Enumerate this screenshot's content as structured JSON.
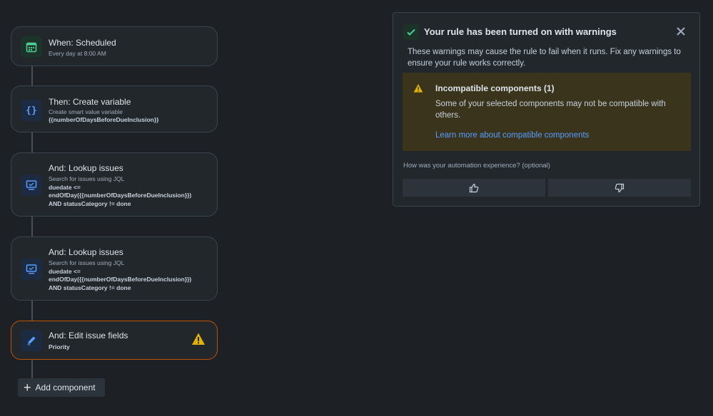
{
  "rule_steps": [
    {
      "title": "When: Scheduled",
      "subtitle": "Every day at 8:00 AM",
      "icon": "calendar-icon"
    },
    {
      "title": "Then: Create variable",
      "subtitle": "Create smart value variable",
      "detail": "{{numberOfDaysBeforeDueInclusion}}",
      "icon": "braces-icon"
    },
    {
      "title": "And: Lookup issues",
      "subtitle": "Search for issues using JQL",
      "detail_lines": [
        "duedate <=",
        "endOfDay({{numberOfDaysBeforeDueInclusion}})",
        "AND statusCategory != done"
      ],
      "icon": "monitor-icon"
    },
    {
      "title": "And: Lookup issues",
      "subtitle": "Search for issues using JQL",
      "detail_lines": [
        "duedate <=",
        "endOfDay({{numberOfDaysBeforeDueInclusion}})",
        "AND statusCategory != done"
      ],
      "icon": "monitor-icon"
    },
    {
      "title": "And: Edit issue fields",
      "detail": "Priority",
      "icon": "pencil-icon",
      "status": "warning"
    }
  ],
  "add_component_label": "Add component",
  "flag": {
    "title": "Your rule has been turned on with warnings",
    "description": "These warnings may cause the rule to fail when it runs. Fix any warnings to ensure your rule works correctly.",
    "warning": {
      "title": "Incompatible components (1)",
      "description": "Some of your selected components may not be compatible with others.",
      "link": "Learn more about compatible components"
    },
    "feedback_question": "How was your automation experience? (optional)"
  },
  "colors": {
    "background": "#1d2125",
    "warning": "#e2b203",
    "warning_border": "#c25100",
    "link": "#579dff",
    "success": "#4bce97"
  }
}
